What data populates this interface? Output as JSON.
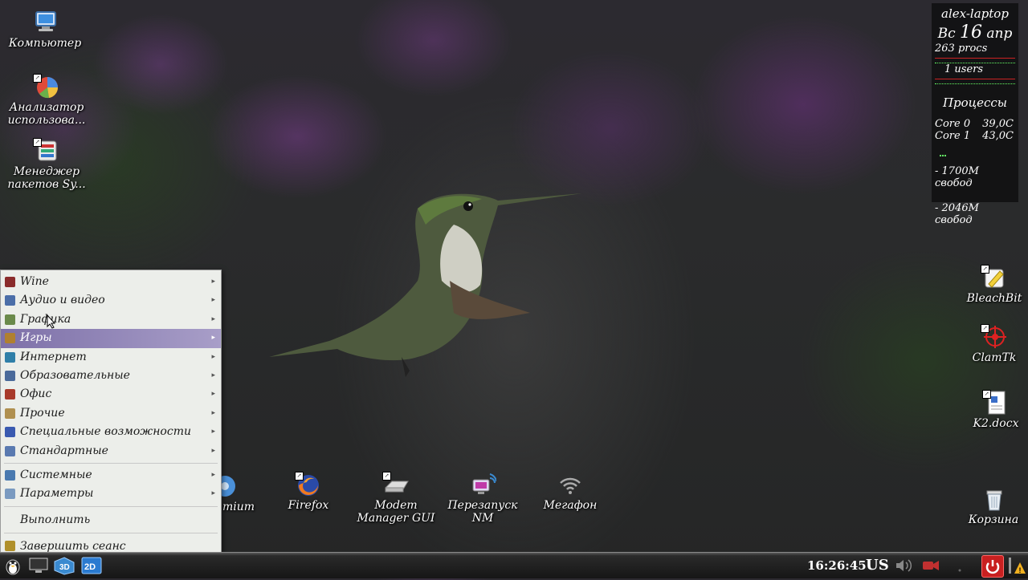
{
  "desktop_left": [
    {
      "label": "Компьютер",
      "icon": "computer-icon"
    },
    {
      "label": "Анализатор использова...",
      "icon": "disk-usage-analyzer-icon"
    },
    {
      "label": "Менеджер пакетов Sy...",
      "icon": "package-manager-icon"
    }
  ],
  "desktop_right": [
    {
      "label": "BleachBit",
      "icon": "bleachbit-icon"
    },
    {
      "label": "ClamTk",
      "icon": "clamtk-icon"
    },
    {
      "label": "K2.docx",
      "icon": "document-icon"
    },
    {
      "label": "Корзина",
      "icon": "trash-icon"
    }
  ],
  "desktop_bottom": [
    {
      "label": "mium",
      "icon": "chromium-icon"
    },
    {
      "label": "Firefox",
      "icon": "firefox-icon"
    },
    {
      "label": "Modem Manager GUI",
      "icon": "modem-icon"
    },
    {
      "label": "Перезапуск NM",
      "icon": "network-restart-icon"
    },
    {
      "label": "Мегафон",
      "icon": "wifi-icon"
    }
  ],
  "conky": {
    "hostname": "alex-laptop",
    "day": "Вс",
    "date_num": "16",
    "month": "апр",
    "procs": "263 procs",
    "users": "1 users",
    "processes_title": "Процессы",
    "cores": [
      {
        "name": "Core 0",
        "temp": "39,0C"
      },
      {
        "name": "Core 1",
        "temp": "43,0C"
      }
    ],
    "free1": "- 1700M свобод",
    "free2": "- 2046M свобод"
  },
  "menu": {
    "items": [
      {
        "label": "Wine",
        "icon": "wine-icon",
        "color": "#8a2b2b",
        "submenu": true
      },
      {
        "label": "Аудио и видео",
        "icon": "multimedia-icon",
        "color": "#4b6ea8",
        "submenu": true
      },
      {
        "label": "Графика",
        "icon": "graphics-icon",
        "color": "#6a8a4a",
        "submenu": true
      },
      {
        "label": "Игры",
        "icon": "games-icon",
        "color": "#b08030",
        "submenu": true,
        "active": true
      },
      {
        "label": "Интернет",
        "icon": "internet-icon",
        "color": "#2f7fa8",
        "submenu": true
      },
      {
        "label": "Образовательные",
        "icon": "education-icon",
        "color": "#4a6a9a",
        "submenu": true
      },
      {
        "label": "Офис",
        "icon": "office-icon",
        "color": "#a83a2a",
        "submenu": true
      },
      {
        "label": "Прочие",
        "icon": "other-icon",
        "color": "#b09050",
        "submenu": true
      },
      {
        "label": "Специальные возможности",
        "icon": "accessibility-icon",
        "color": "#3a5ab0",
        "submenu": true
      },
      {
        "label": "Стандартные",
        "icon": "accessories-icon",
        "color": "#5a7ab0",
        "submenu": true
      }
    ],
    "system_items": [
      {
        "label": "Системные",
        "icon": "system-icon",
        "color": "#4a7ab0",
        "submenu": true
      },
      {
        "label": "Параметры",
        "icon": "settings-icon",
        "color": "#7a9ac0",
        "submenu": true
      }
    ],
    "run_label": "Выполнить",
    "logout_label": "Завершить сеанс"
  },
  "taskbar": {
    "time": "16:26:45",
    "keyboard_layout": "US",
    "launchers": [
      "start-menu-icon",
      "show-desktop-icon",
      "3d-icon",
      "2d-icon"
    ]
  }
}
